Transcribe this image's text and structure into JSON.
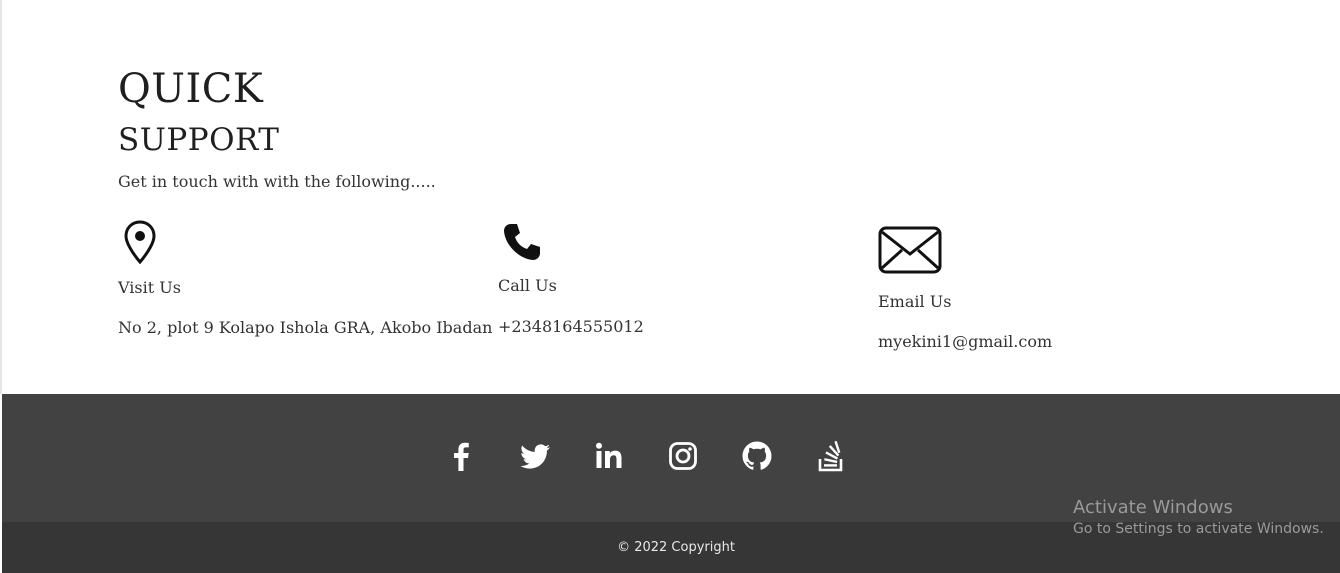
{
  "support": {
    "title_line1": "QUICK",
    "title_line2": "SUPPORT",
    "subtitle": "Get in touch with with the following.....",
    "contacts": [
      {
        "icon": "map-pin-icon",
        "label": "Visit Us",
        "value": "No 2, plot 9 Kolapo Ishola GRA, Akobo Ibadan"
      },
      {
        "icon": "phone-icon",
        "label": "Call Us",
        "value": "+2348164555012"
      },
      {
        "icon": "envelope-icon",
        "label": "Email Us",
        "value": "myekini1@gmail.com"
      }
    ]
  },
  "footer": {
    "social_icons": [
      "facebook-icon",
      "twitter-icon",
      "linkedin-icon",
      "instagram-icon",
      "github-icon",
      "stackoverflow-icon"
    ],
    "copyright": "© 2022 Copyright",
    "colors": {
      "social_bg": "#424242",
      "copyright_bg": "#363636"
    }
  },
  "watermark": {
    "line1": "Activate Windows",
    "line2": "Go to Settings to activate Windows."
  }
}
